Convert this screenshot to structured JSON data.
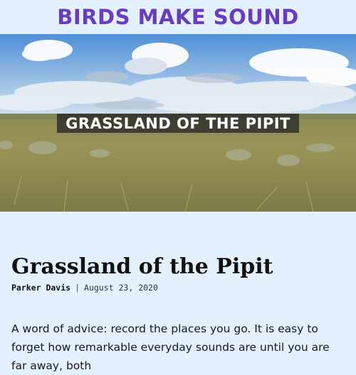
{
  "header": {
    "site_title": "BIRDS MAKE SOUND"
  },
  "hero": {
    "caption": "GRASSLAND OF THE PIPIT",
    "image": "grassland prairie under cloudy blue sky"
  },
  "article": {
    "title": "Grassland of the Pipit",
    "author": "Parker Davis",
    "separator": "|",
    "date": "August 23, 2020",
    "body": "A word of advice: record the places you go. It is easy to forget how remarkable everyday sounds are until you are far away, both"
  },
  "colors": {
    "background": "#e3f0fd",
    "title_accent": "#6a3cc0",
    "caption_bg": "#2b2b2b"
  }
}
